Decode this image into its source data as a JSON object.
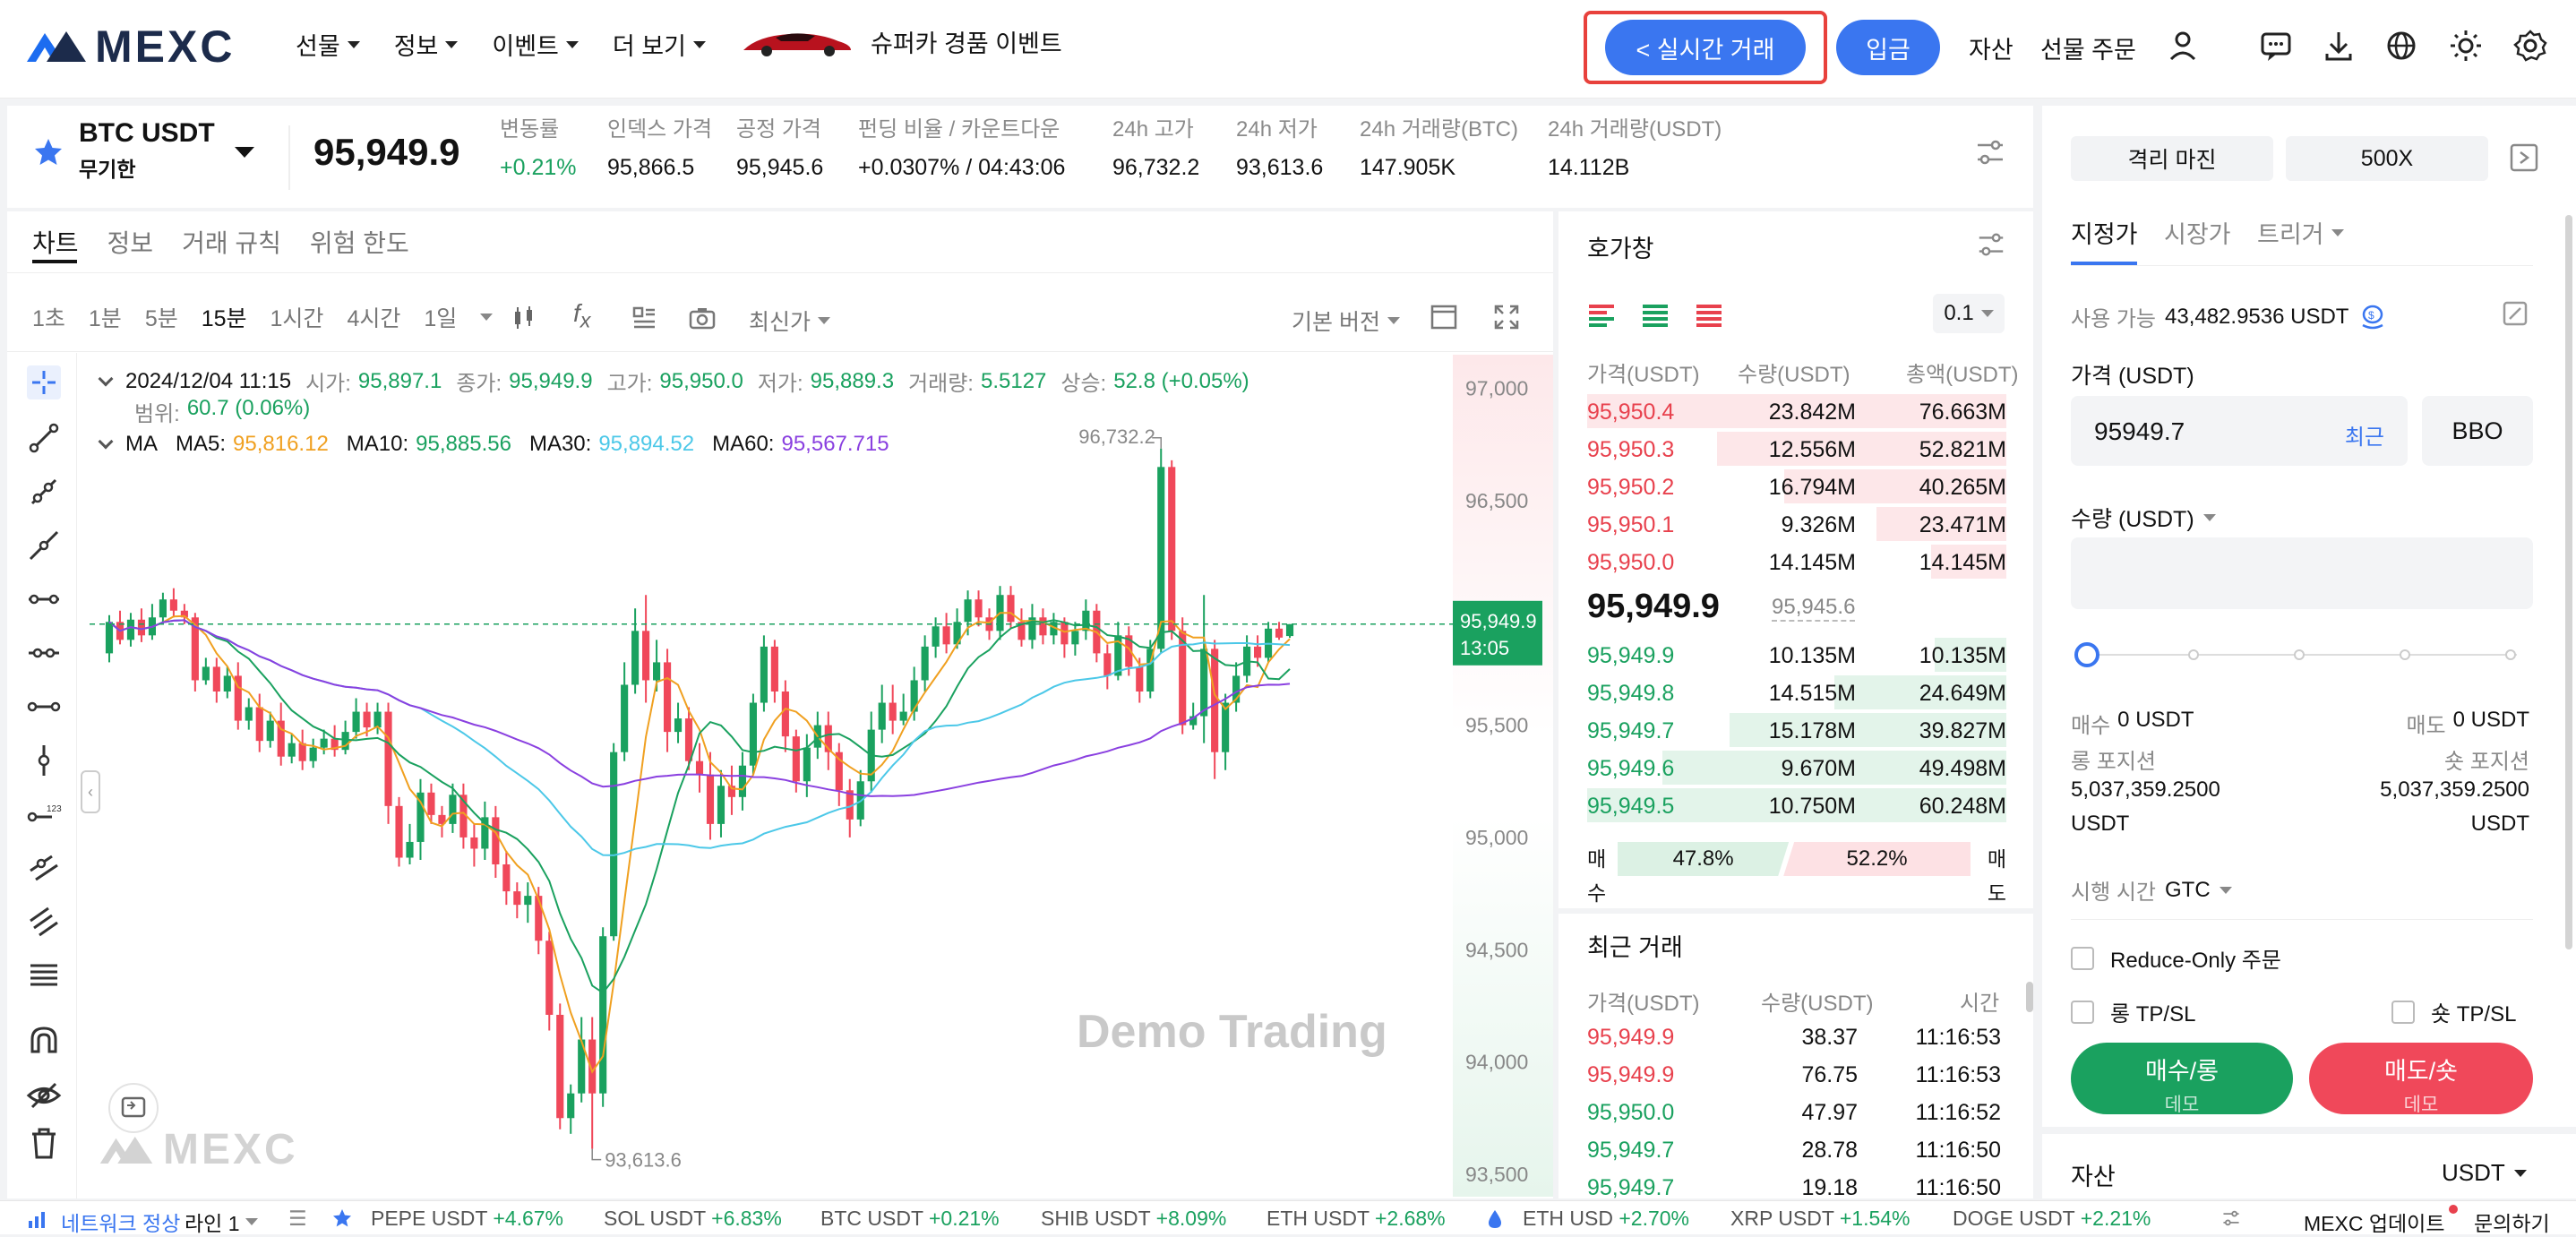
{
  "header": {
    "logo_text": "MEXC",
    "nav": [
      "선물",
      "정보",
      "이벤트",
      "더 보기"
    ],
    "promo_label": "슈퍼카 경품 이벤트",
    "live_trade_label": "< 실시간 거래",
    "deposit_label": "입금",
    "assets_label": "자산",
    "futures_orders_label": "선물 주문",
    "accent_color": "#3a76f0",
    "highlight_color": "#e8413c"
  },
  "ticker": {
    "symbol": "BTC USDT",
    "contract_type": "무기한",
    "last_price": "95,949.9",
    "stats": [
      {
        "label": "변동률",
        "value": "+0.21%"
      },
      {
        "label": "인덱스 가격",
        "value": "95,866.5"
      },
      {
        "label": "공정 가격",
        "value": "95,945.6"
      },
      {
        "label": "펀딩 비율 / 카운트다운",
        "value": "+0.0307% / 04:43:06"
      },
      {
        "label": "24h 고가",
        "value": "96,732.2"
      },
      {
        "label": "24h 저가",
        "value": "93,613.6"
      },
      {
        "label": "24h 거래량(BTC)",
        "value": "147.905K"
      },
      {
        "label": "24h 거래량(USDT)",
        "value": "14.112B"
      }
    ]
  },
  "chart_panel": {
    "tabs": [
      "차트",
      "정보",
      "거래 규칙",
      "위험 한도"
    ],
    "intervals": [
      "1초",
      "1분",
      "5분",
      "15분",
      "1시간",
      "4시간",
      "1일"
    ],
    "selected_interval": "15분",
    "price_type": "최신가",
    "version": "기본 버전",
    "ohlc": {
      "date": "2024/12/04 11:15",
      "open_label": "시가:",
      "open": "95,897.1",
      "close_label": "종가:",
      "close": "95,949.9",
      "high_label": "고가:",
      "high": "95,950.0",
      "low_label": "저가:",
      "low": "95,889.3",
      "volume_label": "거래량:",
      "volume": "5.5127",
      "change_label": "상승:",
      "change": "52.8 (+0.05%)",
      "range_label": "범위:",
      "range": "60.7 (0.06%)"
    },
    "ma": {
      "label": "MA",
      "ma5_label": "MA5:",
      "ma5": "95,816.12",
      "ma10_label": "MA10:",
      "ma10": "95,885.56",
      "ma30_label": "MA30:",
      "ma30": "95,894.52",
      "ma60_label": "MA60:",
      "ma60": "95,567.715"
    },
    "watermark": "Demo Trading",
    "logo_watermark": "MEXC"
  },
  "chart_data": {
    "type": "candlestick",
    "y_ticks": [
      "97,000",
      "96,500",
      "96,000",
      "95,500",
      "95,000",
      "94,500",
      "94,000",
      "93,500"
    ],
    "ylim": [
      93400,
      97150
    ],
    "high_marker": "96,732.2",
    "low_marker": "93,613.6",
    "current_price_label": "95,949.9",
    "countdown_label": "13:05",
    "colors": {
      "up": "#1aa15f",
      "down": "#f0485a",
      "ma5": "#f0a020",
      "ma10": "#1aa15f",
      "ma30": "#4cc8e8",
      "ma60": "#8a40e0"
    },
    "candles": [
      [
        95820,
        95960,
        95780,
        95990
      ],
      [
        95960,
        95880,
        95860,
        96010
      ],
      [
        95880,
        95970,
        95850,
        96000
      ],
      [
        95970,
        95900,
        95870,
        96020
      ],
      [
        95900,
        95980,
        95880,
        96040
      ],
      [
        95980,
        96060,
        95950,
        96090
      ],
      [
        96060,
        96010,
        95980,
        96110
      ],
      [
        96010,
        95980,
        95950,
        96040
      ],
      [
        95980,
        95700,
        95650,
        96000
      ],
      [
        95700,
        95760,
        95680,
        95800
      ],
      [
        95760,
        95650,
        95600,
        95800
      ],
      [
        95650,
        95720,
        95620,
        95760
      ],
      [
        95720,
        95520,
        95480,
        95780
      ],
      [
        95520,
        95580,
        95480,
        95620
      ],
      [
        95580,
        95430,
        95380,
        95640
      ],
      [
        95430,
        95520,
        95400,
        95560
      ],
      [
        95520,
        95360,
        95320,
        95600
      ],
      [
        95360,
        95420,
        95330,
        95460
      ],
      [
        95420,
        95340,
        95300,
        95480
      ],
      [
        95340,
        95400,
        95310,
        95440
      ],
      [
        95400,
        95440,
        95370,
        95480
      ],
      [
        95440,
        95390,
        95360,
        95500
      ],
      [
        95390,
        95470,
        95370,
        95520
      ],
      [
        95470,
        95560,
        95440,
        95620
      ],
      [
        95560,
        95490,
        95450,
        95600
      ],
      [
        95490,
        95560,
        95460,
        95600
      ],
      [
        95560,
        95140,
        95060,
        95600
      ],
      [
        95140,
        94910,
        94870,
        95180
      ],
      [
        94910,
        94980,
        94880,
        95060
      ],
      [
        94980,
        95200,
        94900,
        95260
      ],
      [
        95200,
        95100,
        95060,
        95240
      ],
      [
        95100,
        95060,
        95000,
        95140
      ],
      [
        95060,
        95190,
        95020,
        95240
      ],
      [
        95190,
        95000,
        94950,
        95240
      ],
      [
        95000,
        94950,
        94870,
        95060
      ],
      [
        94950,
        95090,
        94900,
        95160
      ],
      [
        95090,
        94880,
        94820,
        95140
      ],
      [
        94880,
        94760,
        94700,
        94940
      ],
      [
        94760,
        94700,
        94640,
        94800
      ],
      [
        94700,
        94740,
        94620,
        94800
      ],
      [
        94740,
        94540,
        94480,
        94780
      ],
      [
        94540,
        94210,
        94140,
        94580
      ],
      [
        94210,
        93750,
        93700,
        94260
      ],
      [
        93750,
        93860,
        93680,
        93900
      ],
      [
        93860,
        94100,
        93820,
        94200
      ],
      [
        94100,
        93860,
        93613,
        94200
      ],
      [
        93860,
        94560,
        93800,
        94600
      ],
      [
        94560,
        95380,
        94540,
        95420
      ],
      [
        95380,
        95680,
        95340,
        95780
      ],
      [
        95680,
        95920,
        95640,
        96020
      ],
      [
        95920,
        95700,
        95600,
        96080
      ],
      [
        95700,
        95780,
        95650,
        95880
      ],
      [
        95780,
        95470,
        95380,
        95840
      ],
      [
        95470,
        95530,
        95420,
        95600
      ],
      [
        95530,
        95340,
        95300,
        95580
      ],
      [
        95340,
        95280,
        95200,
        95420
      ],
      [
        95280,
        95060,
        94990,
        95380
      ],
      [
        95060,
        95230,
        95000,
        95300
      ],
      [
        95230,
        95180,
        95100,
        95320
      ],
      [
        95180,
        95320,
        95120,
        95380
      ],
      [
        95320,
        95600,
        95280,
        95640
      ],
      [
        95600,
        95850,
        95560,
        95900
      ],
      [
        95850,
        95650,
        95600,
        95880
      ],
      [
        95650,
        95450,
        95380,
        95700
      ],
      [
        95450,
        95250,
        95200,
        95480
      ],
      [
        95250,
        95400,
        95180,
        95460
      ],
      [
        95400,
        95500,
        95350,
        95560
      ],
      [
        95500,
        95380,
        95300,
        95560
      ],
      [
        95380,
        95210,
        95140,
        95420
      ],
      [
        95210,
        95080,
        95000,
        95260
      ],
      [
        95080,
        95250,
        95050,
        95300
      ],
      [
        95250,
        95480,
        95200,
        95560
      ],
      [
        95480,
        95600,
        95420,
        95680
      ],
      [
        95600,
        95520,
        95460,
        95680
      ],
      [
        95520,
        95560,
        95500,
        95640
      ],
      [
        95560,
        95700,
        95520,
        95760
      ],
      [
        95700,
        95850,
        95650,
        95900
      ],
      [
        95850,
        95940,
        95800,
        95980
      ],
      [
        95940,
        95860,
        95820,
        96000
      ],
      [
        95860,
        95960,
        95840,
        96020
      ],
      [
        95960,
        96060,
        95900,
        96100
      ],
      [
        96060,
        95980,
        95940,
        96100
      ],
      [
        95980,
        95920,
        95880,
        96020
      ],
      [
        95920,
        96080,
        95880,
        96120
      ],
      [
        96080,
        95960,
        95930,
        96120
      ],
      [
        95960,
        95880,
        95850,
        96020
      ],
      [
        95880,
        95980,
        95840,
        96040
      ],
      [
        95980,
        95900,
        95860,
        96020
      ],
      [
        95900,
        95960,
        95860,
        96000
      ],
      [
        95960,
        95860,
        95800,
        95980
      ],
      [
        95860,
        95920,
        95810,
        95960
      ],
      [
        95920,
        96010,
        95880,
        96060
      ],
      [
        96010,
        95820,
        95780,
        96040
      ],
      [
        95820,
        95720,
        95660,
        95860
      ],
      [
        95720,
        95900,
        95700,
        95960
      ],
      [
        95900,
        95760,
        95720,
        95940
      ],
      [
        95760,
        95650,
        95600,
        95800
      ],
      [
        95650,
        95840,
        95620,
        95880
      ],
      [
        95840,
        96650,
        95820,
        96732
      ],
      [
        96650,
        95920,
        95880,
        96680
      ],
      [
        95920,
        95500,
        95460,
        95980
      ],
      [
        95500,
        95540,
        95480,
        95600
      ],
      [
        95540,
        95840,
        95420,
        96080
      ],
      [
        95840,
        95380,
        95260,
        95880
      ],
      [
        95380,
        95600,
        95300,
        95640
      ],
      [
        95600,
        95720,
        95560,
        95780
      ],
      [
        95720,
        95850,
        95690,
        95900
      ],
      [
        95850,
        95800,
        95760,
        95900
      ],
      [
        95800,
        95930,
        95780,
        95960
      ],
      [
        95930,
        95890,
        95880,
        95960
      ],
      [
        95897,
        95950,
        95889,
        95950
      ]
    ]
  },
  "order_book": {
    "title": "호가창",
    "precision": "0.1",
    "headers": [
      "가격(USDT)",
      "수량(USDT)",
      "총액(USDT)"
    ],
    "asks": [
      {
        "price": "95,950.4",
        "qty": "23.842M",
        "total": "76.663M",
        "depth": 1.0
      },
      {
        "price": "95,950.3",
        "qty": "12.556M",
        "total": "52.821M",
        "depth": 0.69
      },
      {
        "price": "95,950.2",
        "qty": "16.794M",
        "total": "40.265M",
        "depth": 0.53
      },
      {
        "price": "95,950.1",
        "qty": "9.326M",
        "total": "23.471M",
        "depth": 0.31
      },
      {
        "price": "95,950.0",
        "qty": "14.145M",
        "total": "14.145M",
        "depth": 0.18
      }
    ],
    "mid_price": "95,949.9",
    "mark_price": "95,945.6",
    "bids": [
      {
        "price": "95,949.9",
        "qty": "10.135M",
        "total": "10.135M",
        "depth": 0.17
      },
      {
        "price": "95,949.8",
        "qty": "14.515M",
        "total": "24.649M",
        "depth": 0.41
      },
      {
        "price": "95,949.7",
        "qty": "15.178M",
        "total": "39.827M",
        "depth": 0.66
      },
      {
        "price": "95,949.6",
        "qty": "9.670M",
        "total": "49.498M",
        "depth": 0.82
      },
      {
        "price": "95,949.5",
        "qty": "10.750M",
        "total": "60.248M",
        "depth": 1.0
      }
    ],
    "buy_label_1": "매",
    "buy_label_2": "수",
    "buy_pct": "47.8%",
    "buy_fraction": 0.478,
    "sell_label_1": "매",
    "sell_label_2": "도",
    "sell_pct": "52.2%",
    "sell_fraction": 0.522
  },
  "recent_trades": {
    "title": "최근 거래",
    "headers": [
      "가격(USDT)",
      "수량(USDT)",
      "시간"
    ],
    "rows": [
      {
        "price": "95,949.9",
        "qty": "38.37",
        "time": "11:16:53",
        "side": "sell"
      },
      {
        "price": "95,949.9",
        "qty": "76.75",
        "time": "11:16:53",
        "side": "sell"
      },
      {
        "price": "95,950.0",
        "qty": "47.97",
        "time": "11:16:52",
        "side": "buy"
      },
      {
        "price": "95,949.7",
        "qty": "28.78",
        "time": "11:16:50",
        "side": "buy"
      },
      {
        "price": "95,949.7",
        "qty": "19.18",
        "time": "11:16:50",
        "side": "buy"
      }
    ]
  },
  "order_form": {
    "margin_mode": "격리 마진",
    "leverage": "500X",
    "tabs": [
      "지정가",
      "시장가",
      "트리거"
    ],
    "available_label": "사용 가능",
    "available_value": "43,482.9536 USDT",
    "price_label": "가격 (USDT)",
    "price_value": "95949.7",
    "price_latest": "최근",
    "bbo": "BBO",
    "qty_label": "수량 (USDT)",
    "slider_level": 0,
    "buy_amount_label": "매수",
    "buy_amount": "0 USDT",
    "sell_amount_label": "매도",
    "sell_amount": "0 USDT",
    "long_pos_label": "롱 포지션",
    "long_pos_value_1": "5,037,359.2500",
    "long_pos_value_2": "USDT",
    "short_pos_label": "숏 포지션",
    "short_pos_value_1": "5,037,359.2500",
    "short_pos_value_2": "USDT",
    "tif_label": "시행 시간",
    "tif_value": "GTC",
    "reduce_only": "Reduce-Only 주문",
    "long_tpsl": "롱 TP/SL",
    "short_tpsl": "숏 TP/SL",
    "buy_button": "매수/롱",
    "buy_sub": "데모",
    "sell_button": "매도/숏",
    "sell_sub": "데모",
    "assets_label": "자산",
    "assets_currency": "USDT"
  },
  "bottom_bar": {
    "network_status": "네트워크 정상",
    "line": "라인 1",
    "tickers": [
      {
        "name": "PEPE USDT",
        "change": "+4.67%"
      },
      {
        "name": "SOL USDT",
        "change": "+6.83%"
      },
      {
        "name": "BTC USDT",
        "change": "+0.21%"
      },
      {
        "name": "SHIB USDT",
        "change": "+8.09%"
      },
      {
        "name": "ETH USDT",
        "change": "+2.68%"
      },
      {
        "name": "ETH USD",
        "change": "+2.70%"
      },
      {
        "name": "XRP USDT",
        "change": "+1.54%"
      },
      {
        "name": "DOGE USDT",
        "change": "+2.21%"
      }
    ],
    "mexc_update": "MEXC 업데이트",
    "contact": "문의하기"
  }
}
